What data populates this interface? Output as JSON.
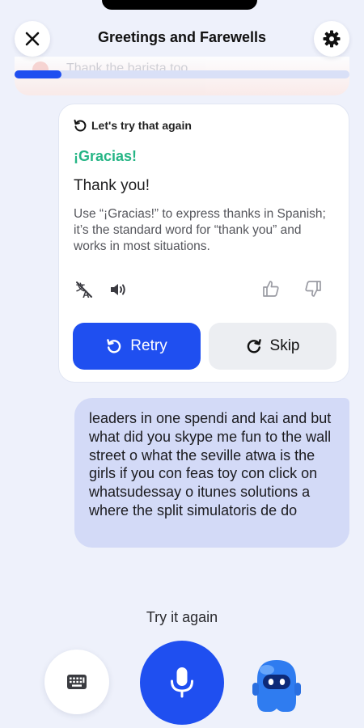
{
  "header": {
    "title": "Greetings and Farewells",
    "close_icon": "close-icon",
    "settings_icon": "gear-icon"
  },
  "previous_line": {
    "text": "Thank the barista too"
  },
  "progress": {
    "fraction": 0.14,
    "accent": "#1f4ff0"
  },
  "feedback": {
    "heading": "Let's try that again",
    "phrase": "¡Gracias!",
    "translation": "Thank you!",
    "explanation": "Use “¡Gracias!” to express thanks in Spanish; it’s the standard word for “thank you” and works in most situations.",
    "retry_label": "Retry",
    "skip_label": "Skip",
    "phrase_color": "#25b585"
  },
  "user_message": {
    "text": "leaders in one spendi and kai and but what did you skype me fun to the wall street o what the seville atwa is the girls if you con feas toy con click on whatsudessay o itunes solutions a where the split simulatoris de do"
  },
  "bottom": {
    "prompt": "Try it again",
    "keyboard_icon": "keyboard-icon",
    "mic_icon": "microphone-icon",
    "mascot_icon": "robot-mascot-icon"
  }
}
